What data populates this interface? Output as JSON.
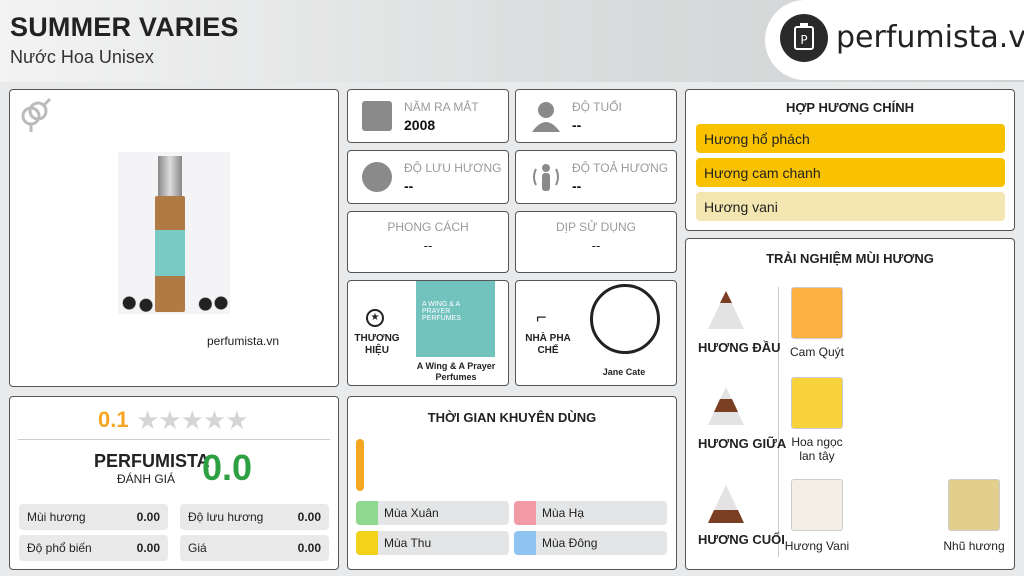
{
  "header": {
    "title": "SUMMER VARIES",
    "subtitle": "Nước Hoa Unisex",
    "brand": "perfumista.vn"
  },
  "product": {
    "bottle_label": "A WING & A PRAYER PERFUMES",
    "watermark": "perfumista.vn"
  },
  "info": {
    "year": {
      "label": "NĂM RA MẮT",
      "value": "2008"
    },
    "age": {
      "label": "ĐỘ TUỔI",
      "value": "--"
    },
    "longevity": {
      "label": "ĐỘ LƯU HƯƠNG",
      "value": "--"
    },
    "sillage": {
      "label": "ĐỘ TOẢ HƯƠNG",
      "value": "--"
    },
    "style": {
      "label": "PHONG CÁCH",
      "value": "--"
    },
    "occasion": {
      "label": "DỊP SỬ DỤNG",
      "value": "--"
    },
    "brand": {
      "label": "THƯƠNG HIỆU",
      "name": "A Wing & A Prayer Perfumes",
      "logo_text": "A WING & A PRAYER PERFUMES"
    },
    "perfumer": {
      "label": "NHÀ PHA CHẾ",
      "name": "Jane Cate"
    }
  },
  "accords": {
    "title": "HỢP HƯƠNG CHÍNH",
    "items": [
      {
        "name": "Hương hổ phách",
        "color": "#f8c200"
      },
      {
        "name": "Hương cam chanh",
        "color": "#f8c200"
      },
      {
        "name": "Hương vani",
        "color": "#f3e6b0"
      }
    ]
  },
  "notes": {
    "title": "TRẢI NGHIỆM MÙI HƯƠNG",
    "top": {
      "label": "HƯƠNG ĐẦU",
      "items": [
        "Cam Quýt"
      ]
    },
    "middle": {
      "label": "HƯƠNG GIỮA",
      "items": [
        "Hoa ngọc lan tây"
      ]
    },
    "base": {
      "label": "HƯƠNG CUỐI",
      "items": [
        "Hương Vani",
        "Nhũ hương"
      ]
    }
  },
  "rating": {
    "user_score": "0.1",
    "stars": 5,
    "perfumista_label": "PERFUMISTA",
    "perfumista_sub": "ĐÁNH GIÁ",
    "perfumista_score": "0.0",
    "stats": [
      {
        "label": "Mùi hương",
        "value": "0.00"
      },
      {
        "label": "Độ lưu hương",
        "value": "0.00"
      },
      {
        "label": "Độ phổ biến",
        "value": "0.00"
      },
      {
        "label": "Giá",
        "value": "0.00"
      }
    ]
  },
  "season": {
    "title": "THỜI GIAN KHUYÊN DÙNG",
    "items": [
      {
        "name": "Mùa Xuân",
        "color": "#8fd88f"
      },
      {
        "name": "Mùa Hạ",
        "color": "#f29aa6"
      },
      {
        "name": "Mùa Thu",
        "color": "#f2d21b"
      },
      {
        "name": "Mùa Đông",
        "color": "#8fc4f2"
      }
    ]
  },
  "colors": {
    "accent": "#f8c200",
    "score_green": "#2ea043",
    "bar_orange": "#f5a623"
  }
}
